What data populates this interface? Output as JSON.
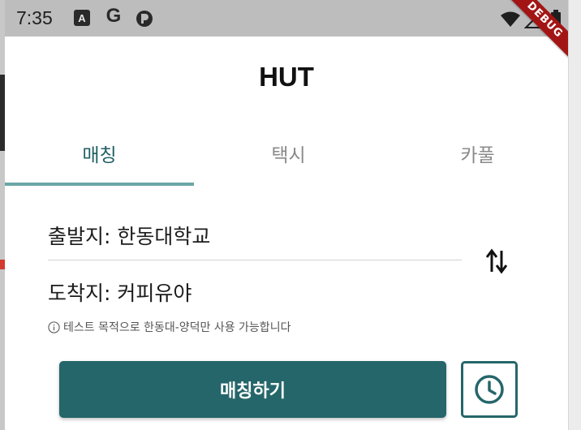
{
  "status_bar": {
    "time": "7:35",
    "notification_icons": [
      "a-box-icon",
      "google-g-icon",
      "app-p-icon"
    ],
    "debug_banner": "DEBUG",
    "right_icons": [
      "wifi-icon",
      "signal-icon",
      "battery-icon"
    ],
    "a_icon_letter": "A",
    "g_icon_letter": "G"
  },
  "app_bar": {
    "title": "HUT"
  },
  "tabs": [
    {
      "label": "매칭",
      "selected": true
    },
    {
      "label": "택시",
      "selected": false
    },
    {
      "label": "카풀",
      "selected": false
    }
  ],
  "route": {
    "departure": "출발지: 한동대학교",
    "destination": "도착지: 커피유야",
    "notice": "테스트 목적으로 한동대-양덕만 사용 가능합니다"
  },
  "actions": {
    "match_label": "매칭하기"
  },
  "colors": {
    "primary": "#25666a",
    "tab_selected": "#1f5f63",
    "tab_indicator": "#6aa7a6",
    "tab_unselected": "#8a8a8a",
    "status_bar": "#bdbdbd",
    "debug_banner": "#a31515"
  }
}
